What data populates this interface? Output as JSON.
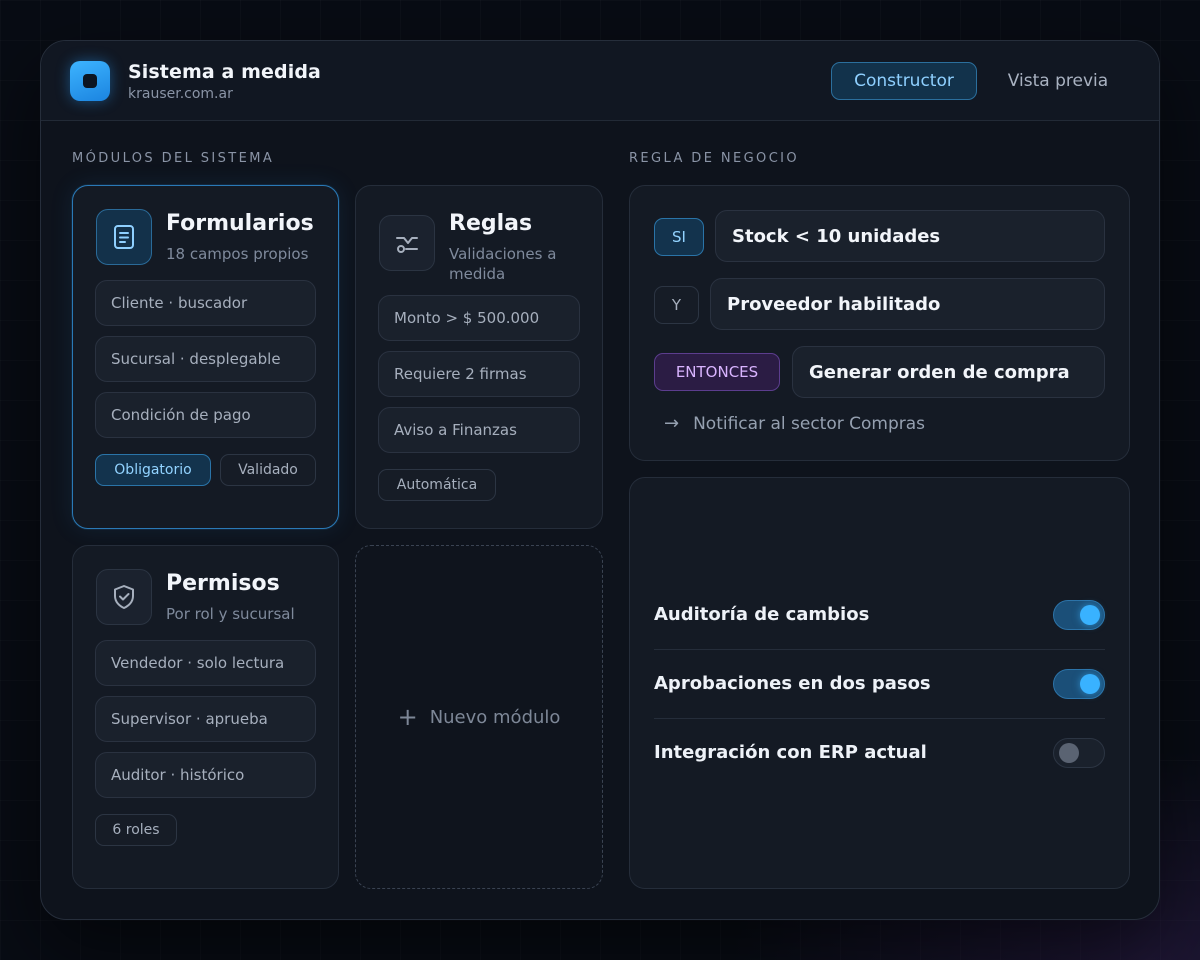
{
  "app": {
    "title": "Sistema a medida",
    "subtitle": "krauser.com.ar",
    "accent": "#39b2ff"
  },
  "tabs": {
    "constructor": "Constructor",
    "preview": "Vista previa",
    "active": "Constructor"
  },
  "modules": {
    "section_label": "MÓDULOS DEL SISTEMA",
    "formularios": {
      "title": "Formularios",
      "subtitle": "18 campos propios",
      "icon": "document-icon",
      "items": [
        "Cliente · buscador",
        "Sucursal · desplegable",
        "Condición de pago"
      ],
      "tags": [
        "Obligatorio",
        "Validado"
      ]
    },
    "reglas": {
      "title": "Reglas",
      "subtitle": "Validaciones a medida",
      "icon": "branch-icon",
      "items": [
        "Monto > $ 500.000",
        "Requiere 2 firmas",
        "Aviso a Finanzas"
      ],
      "tags": [
        "Automática"
      ]
    },
    "permisos": {
      "title": "Permisos",
      "subtitle": "Por rol y sucursal",
      "icon": "shield-icon",
      "items": [
        "Vendedor · solo lectura",
        "Supervisor · aprueba",
        "Auditor · histórico"
      ],
      "tags": [
        "6 roles"
      ]
    },
    "new_module": "Nuevo módulo"
  },
  "rule": {
    "section_label": "REGLA DE NEGOCIO",
    "if_label": "SI",
    "if_value": "Stock < 10 unidades",
    "and_label": "Y",
    "and_value": "Proveedor habilitado",
    "then_label": "ENTONCES",
    "then_value": "Generar orden de compra",
    "then_extra": "Notificar al sector Compras"
  },
  "settings": {
    "toggles": [
      {
        "label": "Auditoría de cambios",
        "on": true
      },
      {
        "label": "Aprobaciones en dos pasos",
        "on": true
      },
      {
        "label": "Integración con ERP actual",
        "on": false
      }
    ]
  }
}
